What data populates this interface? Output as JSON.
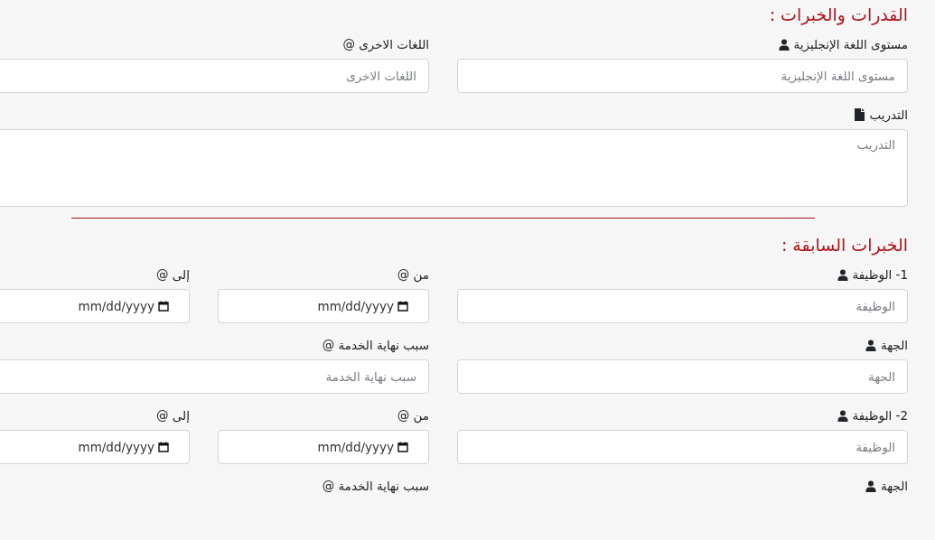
{
  "sections": [
    {
      "title": "القدرات والخبرات :",
      "rows": [
        {
          "fields": [
            {
              "kind": "text",
              "label": "مستوى اللغة الإنجليزية",
              "placeholder": "مستوى اللغة الإنجليزية"
            },
            {
              "kind": "text",
              "label": "اللغات الاخرى @",
              "placeholder": "اللغات الاخرى"
            }
          ]
        },
        {
          "fields": [
            {
              "kind": "textarea",
              "label": "التدريب",
              "placeholder": "التدريب"
            }
          ]
        }
      ]
    },
    {
      "title": "الخبرات السابقة :",
      "rows": [
        {
          "fields": [
            {
              "kind": "text",
              "label": "1- الوظيفة",
              "placeholder": "الوظيفة"
            },
            {
              "kind": "date",
              "label": "من @",
              "placeholder": "mm/dd/yyyy"
            },
            {
              "kind": "date",
              "label": "إلى @",
              "placeholder": "mm/dd/yyyy"
            }
          ]
        },
        {
          "fields": [
            {
              "kind": "text",
              "label": "الجهة",
              "placeholder": "الجهة"
            },
            {
              "kind": "text",
              "label": "سبب نهاية الخدمة @",
              "placeholder": "سبب نهاية الخدمة"
            }
          ]
        },
        {
          "fields": [
            {
              "kind": "text",
              "label": "2- الوظيفة",
              "placeholder": "الوظيفة"
            },
            {
              "kind": "date",
              "label": "من @",
              "placeholder": "mm/dd/yyyy"
            },
            {
              "kind": "date",
              "label": "إلى @",
              "placeholder": "mm/dd/yyyy"
            }
          ]
        },
        {
          "fields": [
            {
              "kind": "text",
              "label": "الجهة"
            },
            {
              "kind": "text",
              "label": "سبب نهاية الخدمة @"
            }
          ]
        }
      ]
    }
  ]
}
